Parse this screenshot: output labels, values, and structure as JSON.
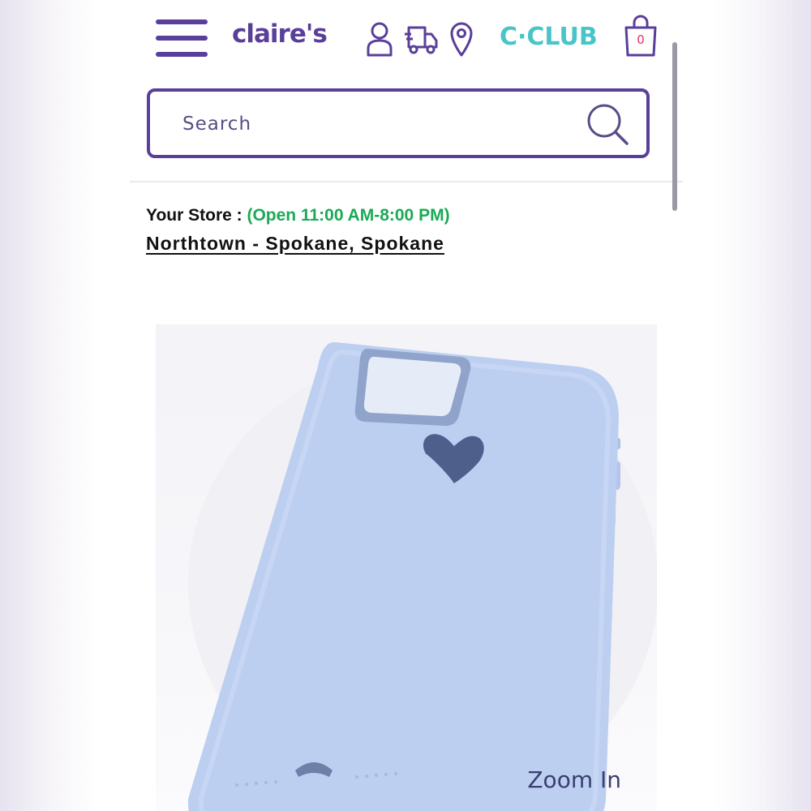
{
  "header": {
    "menu_icon": "hamburger-menu-icon",
    "logo_text": "claire's",
    "icons": [
      "account-icon",
      "delivery-truck-icon",
      "location-pin-icon"
    ],
    "club_text": "C·CLUB",
    "bag_icon": "shopping-bag-icon",
    "bag_count": "0"
  },
  "search": {
    "placeholder": "Search",
    "icon": "search-icon"
  },
  "store": {
    "label": "Your Store : ",
    "hours": "(Open 11:00 AM-8:00 PM)",
    "name": "Northtown - Spokane, Spokane"
  },
  "product": {
    "image_icon": "phone-case-image",
    "zoom_label": "Zoom In"
  },
  "colors": {
    "brand": "#5a3f9a",
    "club": "#49c4c9",
    "open_hours": "#1aaa55",
    "case": "#bccff0",
    "heart": "#4f5f8c"
  }
}
